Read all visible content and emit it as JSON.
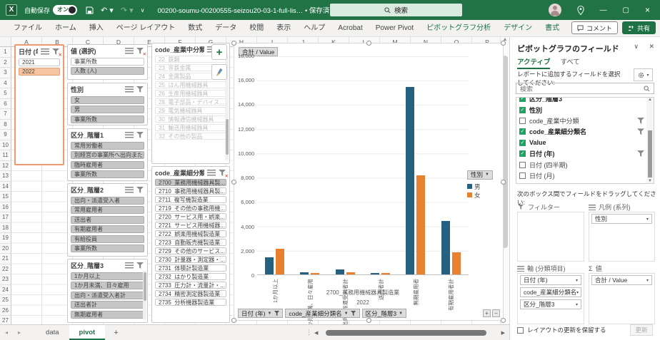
{
  "colors": {
    "brand_green": "#217346",
    "bar_male": "#26607F",
    "bar_female": "#E8802F",
    "slicer_accent": "#F6C5A0",
    "checked_green": "#21A366"
  },
  "titlebar": {
    "app": "X",
    "autosave_label": "自動保存",
    "autosave_state": "オン",
    "filename": "00200-soumu-00200555-seizou20-03-1-full-lis…  • 保存済み ∨",
    "search": "検索"
  },
  "ribbon": {
    "tabs": [
      {
        "label": "ファイル",
        "cls": "rtab"
      },
      {
        "label": "ホーム",
        "cls": "rtab"
      },
      {
        "label": "挿入",
        "cls": "rtab"
      },
      {
        "label": "ページ レイアウト",
        "cls": "rtab"
      },
      {
        "label": "数式",
        "cls": "rtab"
      },
      {
        "label": "データ",
        "cls": "rtab"
      },
      {
        "label": "校閲",
        "cls": "rtab"
      },
      {
        "label": "表示",
        "cls": "rtab"
      },
      {
        "label": "ヘルプ",
        "cls": "rtab"
      },
      {
        "label": "Acrobat",
        "cls": "rtab"
      },
      {
        "label": "Power Pivot",
        "cls": "rtab"
      },
      {
        "label": "ピボットグラフ分析",
        "cls": "rtab ctx"
      },
      {
        "label": "デザイン",
        "cls": "rtab ctx"
      },
      {
        "label": "書式",
        "cls": "rtab ctx"
      }
    ],
    "comment": "コメント",
    "share": "共有"
  },
  "grid": {
    "columns": [
      "A",
      "B",
      "C",
      "D",
      "E",
      "F",
      "G",
      "H",
      "I",
      "J",
      "K",
      "L",
      "M",
      "N",
      "O",
      "P"
    ],
    "rows": [
      "1",
      "2",
      "3",
      "4",
      "5",
      "6",
      "7",
      "8",
      "9",
      "10",
      "11",
      "12",
      "13",
      "14",
      "15",
      "16",
      "17",
      "18",
      "19",
      "20",
      "21",
      "22",
      "23",
      "24",
      "25",
      "26",
      "27"
    ]
  },
  "slicers": {
    "date": {
      "title": "日付 (年)",
      "funnel_cls": "ic-funnel rx",
      "items": [
        {
          "label": "2021",
          "cls": "sl-item"
        },
        {
          "label": "2022",
          "cls": "sl-item accent"
        }
      ]
    },
    "value": {
      "title": "値 (選択)",
      "funnel_cls": "ic-funnel rx",
      "items": [
        {
          "label": "事業所数",
          "cls": "sl-item"
        },
        {
          "label": "人数 (人)",
          "cls": "sl-item graysel"
        }
      ]
    },
    "gender": {
      "title": "性別",
      "funnel_cls": "ic-funnel",
      "items": [
        {
          "label": "女",
          "cls": "sl-item graysel"
        },
        {
          "label": "男",
          "cls": "sl-item graysel"
        },
        {
          "label": "事業所数",
          "cls": "sl-item graysel"
        }
      ]
    },
    "k1": {
      "title": "区分_階層1",
      "funnel_cls": "ic-funnel",
      "items": [
        {
          "label": "常用労働者",
          "cls": "sl-item graysel"
        },
        {
          "label": "別経営の事業所へ出向または派...",
          "cls": "sl-item graysel"
        },
        {
          "label": "臨時雇用者",
          "cls": "sl-item graysel"
        },
        {
          "label": "事業所数",
          "cls": "sl-item graysel"
        }
      ]
    },
    "k2": {
      "title": "区分_階層2",
      "funnel_cls": "ic-funnel",
      "items": [
        {
          "label": "出向・派遣受入者",
          "cls": "sl-item graysel"
        },
        {
          "label": "常用雇用者",
          "cls": "sl-item graysel"
        },
        {
          "label": "送出者",
          "cls": "sl-item graysel"
        },
        {
          "label": "有期雇用者",
          "cls": "sl-item graysel"
        },
        {
          "label": "有給役員",
          "cls": "sl-item graysel"
        },
        {
          "label": "事業所数",
          "cls": "sl-item graysel"
        }
      ]
    },
    "k3": {
      "title": "区分_階層3",
      "funnel_cls": "ic-funnel",
      "items": [
        {
          "label": "1か月以上",
          "cls": "sl-item graysel"
        },
        {
          "label": "1か月未満、日々雇用",
          "cls": "sl-item graysel"
        },
        {
          "label": "出向・派遣受入者計",
          "cls": "sl-item graysel"
        },
        {
          "label": "送出者計",
          "cls": "sl-item graysel"
        },
        {
          "label": "無期雇用者",
          "cls": "sl-item graysel"
        }
      ]
    },
    "mid": {
      "title": "code_産業中分類",
      "funnel_cls": "ic-funnel",
      "items": [
        {
          "label": "22_鉄鋼",
          "cls": "sl-item nodata"
        },
        {
          "label": "23_非鉄金属",
          "cls": "sl-item nodata"
        },
        {
          "label": "24_金属製品",
          "cls": "sl-item nodata"
        },
        {
          "label": "25_はん用機械器具",
          "cls": "sl-item nodata"
        },
        {
          "label": "26_生産用機械器具",
          "cls": "sl-item nodata"
        },
        {
          "label": "28_電子部品・デバイス...",
          "cls": "sl-item nodata"
        },
        {
          "label": "29_電気機械器具",
          "cls": "sl-item nodata"
        },
        {
          "label": "30_情報通信機械器具",
          "cls": "sl-item nodata"
        },
        {
          "label": "31_輸送用機械器具",
          "cls": "sl-item nodata"
        },
        {
          "label": "32_その他の製品",
          "cls": "sl-item nodata"
        }
      ]
    },
    "detail": {
      "title": "code_産業細分類名",
      "funnel_cls": "ic-funnel rx",
      "items": [
        {
          "label": "2700_業務用機械器具製...",
          "cls": "sl-item graysel"
        },
        {
          "label": "2710_事務用機械器具製...",
          "cls": "sl-item"
        },
        {
          "label": "2711_複写機製造業",
          "cls": "sl-item"
        },
        {
          "label": "2719_その他の事務用機...",
          "cls": "sl-item"
        },
        {
          "label": "2720_サービス用・娯楽...",
          "cls": "sl-item"
        },
        {
          "label": "2721_サービス用機械器...",
          "cls": "sl-item"
        },
        {
          "label": "2722_娯楽用機械製造業",
          "cls": "sl-item"
        },
        {
          "label": "2723_自動販売機製造業",
          "cls": "sl-item"
        },
        {
          "label": "2729_その他のサービス...",
          "cls": "sl-item"
        },
        {
          "label": "2730_計量器・測定器・...",
          "cls": "sl-item"
        },
        {
          "label": "2731_体積計製造業",
          "cls": "sl-item"
        },
        {
          "label": "2732_はかり製造業",
          "cls": "sl-item"
        },
        {
          "label": "2733_圧力計・流量計・...",
          "cls": "sl-item"
        },
        {
          "label": "2734_精密測定器製造業",
          "cls": "sl-item"
        },
        {
          "label": "2735_分析機器製造業",
          "cls": "sl-item"
        }
      ]
    }
  },
  "chart": {
    "value_button": "合計 / Value",
    "yticks": [
      "18,000",
      "16,000",
      "14,000",
      "12,000",
      "10,000",
      "8,000",
      "6,000",
      "4,000",
      "2,000",
      "0"
    ],
    "categories": [
      {
        "label": "1か月以上",
        "m_style": "height:7.8%",
        "f_style": "height:11.7%"
      },
      {
        "label": "1か月未満、日々雇用",
        "m_style": "height:1.1%",
        "f_style": "height:0.7%"
      },
      {
        "label": "出向・派遣受入者計",
        "m_style": "height:2.2%",
        "f_style": "height:1.1%"
      },
      {
        "label": "送出者計",
        "m_style": "height:0.8%",
        "f_style": "height:0.6%"
      },
      {
        "label": "無期雇用者",
        "m_style": "height:86.1%",
        "f_style": "height:45.3%"
      },
      {
        "label": "有期雇用者計",
        "m_style": "height:24.4%",
        "f_style": "height:10.0%"
      }
    ],
    "group_label": "2700_業務用機械器具製造業",
    "year_label": "2022",
    "legend": {
      "button": "性別",
      "items": [
        {
          "label": "男",
          "sw_style": "background:#26607F"
        },
        {
          "label": "女",
          "sw_style": "background:#E8802F"
        }
      ]
    },
    "field_buttons": [
      {
        "label": "日付 (年)",
        "fun_cls": "fb-funnel"
      },
      {
        "label": "code_産業細分類名",
        "fun_cls": "fb-funnel"
      },
      {
        "label": "区分_階層3",
        "fun_cls": "fb-funnel hide"
      }
    ],
    "zoom_plus": "+",
    "zoom_minus": "−"
  },
  "chart_data": {
    "type": "bar",
    "categories": [
      "1か月以上",
      "1か月未満、日々雇用",
      "出向・派遣受入者計",
      "送出者計",
      "無期雇用者",
      "有期雇用者計"
    ],
    "series": [
      {
        "name": "男",
        "values": [
          1400,
          200,
          400,
          150,
          15500,
          4400
        ]
      },
      {
        "name": "女",
        "values": [
          2100,
          130,
          200,
          100,
          8150,
          1800
        ]
      }
    ],
    "group": "2700_業務用機械器具製造業",
    "year": "2022",
    "ylabel": "合計 / Value",
    "ylim": [
      0,
      18000
    ],
    "grid": true,
    "legend_title": "性別",
    "legend_position": "right"
  },
  "fields_panel": {
    "title": "ピボットグラフのフィールド",
    "tabs": {
      "active": "アクティブ",
      "all": "すべて"
    },
    "choose_hint": "レポートに追加するフィールドを選択してください:",
    "search_placeholder": "検索",
    "fields": [
      {
        "label": "区分_階層3",
        "row_cls": "fl-row b",
        "cb_cls": "cb on",
        "fun_cls": "ic-funnel flf hide"
      },
      {
        "label": "性別",
        "row_cls": "fl-row b",
        "cb_cls": "cb on",
        "fun_cls": "ic-funnel flf hide"
      },
      {
        "label": "code_産業中分類",
        "row_cls": "fl-row",
        "cb_cls": "cb",
        "fun_cls": "ic-funnel flf"
      },
      {
        "label": "code_産業細分類名",
        "row_cls": "fl-row b",
        "cb_cls": "cb on",
        "fun_cls": "ic-funnel flf"
      },
      {
        "label": "Value",
        "row_cls": "fl-row b",
        "cb_cls": "cb on",
        "fun_cls": "ic-funnel flf hide"
      },
      {
        "label": "日付 (年)",
        "row_cls": "fl-row b",
        "cb_cls": "cb on",
        "fun_cls": "ic-funnel flf"
      },
      {
        "label": "日付 (四半期)",
        "row_cls": "fl-row",
        "cb_cls": "cb",
        "fun_cls": "ic-funnel flf hide"
      },
      {
        "label": "日付 (月)",
        "row_cls": "fl-row",
        "cb_cls": "cb",
        "fun_cls": "ic-funnel flf hide"
      }
    ],
    "drag_hint": "次のボックス間でフィールドをドラッグしてください:",
    "areas": {
      "filter": {
        "label": "フィルター",
        "items": []
      },
      "legend": {
        "label": "凡例 (系列)",
        "items": [
          "性別"
        ]
      },
      "axis": {
        "label": "軸 (分類項目)",
        "items": [
          "日付 (年)",
          "code_産業細分類名",
          "区分_階層3"
        ]
      },
      "values": {
        "label": "値",
        "items": [
          "合計 / Value"
        ]
      }
    },
    "defer_label": "レイアウトの更新を保留する",
    "update_button": "更新"
  },
  "sheet_tabs": {
    "tabs": [
      {
        "label": "data",
        "cls": "stab"
      },
      {
        "label": "pivot",
        "cls": "stab on"
      }
    ],
    "add": "+"
  }
}
